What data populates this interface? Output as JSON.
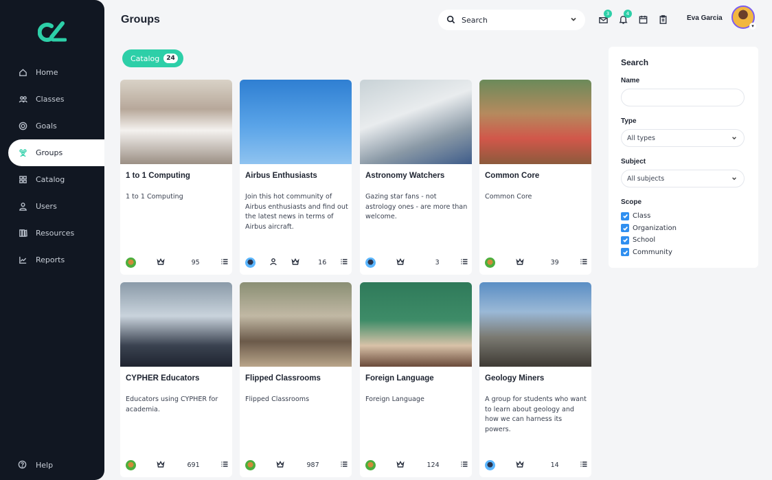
{
  "page": {
    "title": "Groups"
  },
  "sidebar": {
    "items": [
      {
        "label": "Home",
        "icon": "home-icon"
      },
      {
        "label": "Classes",
        "icon": "classes-icon"
      },
      {
        "label": "Goals",
        "icon": "goals-icon"
      },
      {
        "label": "Groups",
        "icon": "groups-icon",
        "active": true
      },
      {
        "label": "Catalog",
        "icon": "catalog-icon"
      },
      {
        "label": "Users",
        "icon": "users-icon"
      },
      {
        "label": "Resources",
        "icon": "resources-icon"
      },
      {
        "label": "Reports",
        "icon": "reports-icon"
      }
    ],
    "help": "Help"
  },
  "header": {
    "search": "Search",
    "user_name": "Eva Garcia",
    "notification_badges": [
      "3",
      "4"
    ]
  },
  "catalog": {
    "label": "Catalog",
    "count": "24"
  },
  "cards": [
    {
      "title": "1 to 1 Computing",
      "description": "1 to 1 Computing",
      "count": "95",
      "avatar": "green"
    },
    {
      "title": "Airbus Enthusiasts",
      "description": "Join this hot community of Airbus enthusiasts and find out the latest news in terms of Airbus aircraft.",
      "count": "16",
      "avatar": "blue"
    },
    {
      "title": "Astronomy Watchers",
      "description": "Gazing star fans - not astrology ones - are more than welcome.",
      "count": "3",
      "avatar": "blue"
    },
    {
      "title": "Common Core",
      "description": "Common Core",
      "count": "39",
      "avatar": "green"
    },
    {
      "title": "CYPHER Educators",
      "description": "Educators using CYPHER for academia.",
      "count": "691",
      "avatar": "green"
    },
    {
      "title": "Flipped Classrooms",
      "description": "Flipped Classrooms",
      "count": "987",
      "avatar": "green"
    },
    {
      "title": "Foreign Language",
      "description": "Foreign Language",
      "count": "124",
      "avatar": "green"
    },
    {
      "title": "Geology Miners",
      "description": "A group for students who want to learn about geology and how we can harness its powers.",
      "count": "14",
      "avatar": "blue"
    }
  ],
  "filter": {
    "title": "Search",
    "name_label": "Name",
    "type_label": "Type",
    "type_value": "All types",
    "subject_label": "Subject",
    "subject_value": "All subjects",
    "scope_label": "Scope",
    "scope_options": [
      "Class",
      "Organization",
      "School",
      "Community"
    ]
  },
  "colors": {
    "accent": "#2dcfa8",
    "sidebar": "#111722",
    "checkbox": "#2f8ff0"
  }
}
